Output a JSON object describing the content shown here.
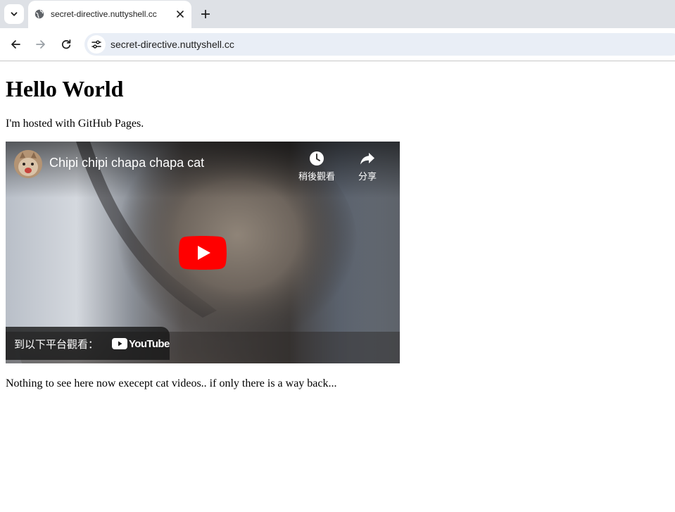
{
  "browser": {
    "tab": {
      "title": "secret-directive.nuttyshell.cc"
    },
    "address_bar": {
      "url": "secret-directive.nuttyshell.cc"
    },
    "icons": {
      "tab_search": "chevron-down-icon",
      "favicon": "globe-icon",
      "tab_close": "close-icon",
      "new_tab": "plus-icon",
      "back": "arrow-left-icon",
      "forward": "arrow-right-icon",
      "reload": "reload-icon",
      "site_info": "tune-icon"
    }
  },
  "page": {
    "heading": "Hello World",
    "intro": "I'm hosted with GitHub Pages.",
    "footer_text": "Nothing to see here now execept cat videos.. if only there is a way back..."
  },
  "video": {
    "title": "Chipi chipi chapa chapa cat",
    "watch_later_label": "稍後觀看",
    "share_label": "分享",
    "watch_on_label": "到以下平台觀看：",
    "platform_logo_text": "YouTube",
    "colors": {
      "play_button": "#ff0000",
      "overlay": "#171717"
    }
  }
}
